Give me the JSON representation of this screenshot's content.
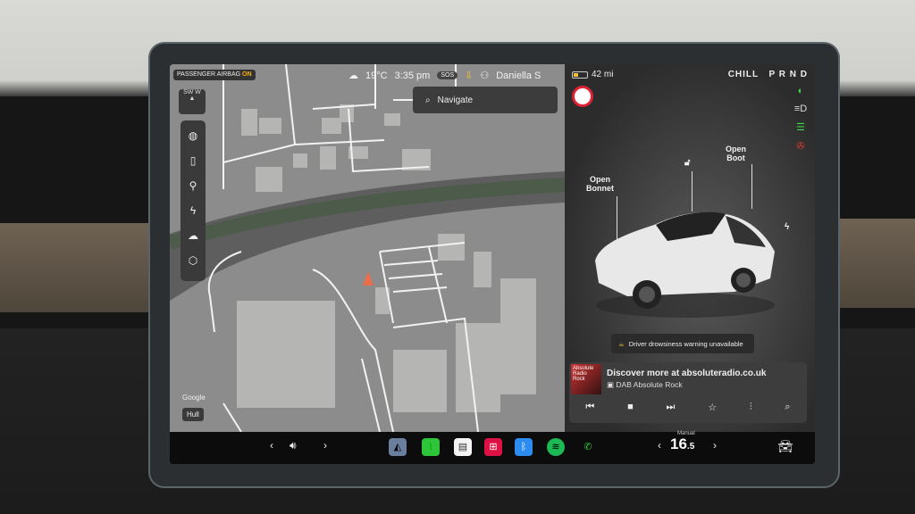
{
  "status": {
    "airbag_label": "PASSENGER AIRBAG",
    "airbag_state": "ON",
    "temperature": "19°C",
    "time": "3:35 pm",
    "sos_label": "SOS",
    "user_name": "Daniella S",
    "range": "42 mi",
    "drive_mode": "CHILL",
    "gears": "P R N D"
  },
  "map": {
    "navigate_placeholder": "Navigate",
    "google_label": "Google",
    "location_label": "Hull",
    "compass_label": "SW W",
    "toolbar_icons": [
      "globe-icon",
      "phone-icon",
      "pin-icon",
      "charging-icon",
      "weather-icon",
      "3d-cube-icon"
    ]
  },
  "car": {
    "open_bonnet": "Open\nBonnet",
    "open_boot": "Open\nBoot",
    "warning_text": "Driver drowsiness warning unavailable",
    "lights_icons": [
      "headlight-icon",
      "auto-highbeam-icon",
      "parking-light-icon",
      "seatbelt-warning-icon"
    ],
    "colors": {
      "warning_red": "#e03b2f",
      "light_green": "#3fd24a"
    }
  },
  "media": {
    "title": "Discover more at absoluteradio.co.uk",
    "source": "DAB Absolute Rock",
    "art_label": "Absolute Radio Rock"
  },
  "bottom": {
    "climate_mode": "Manual",
    "temperature_whole": "16",
    "temperature_decimal": ".5"
  }
}
